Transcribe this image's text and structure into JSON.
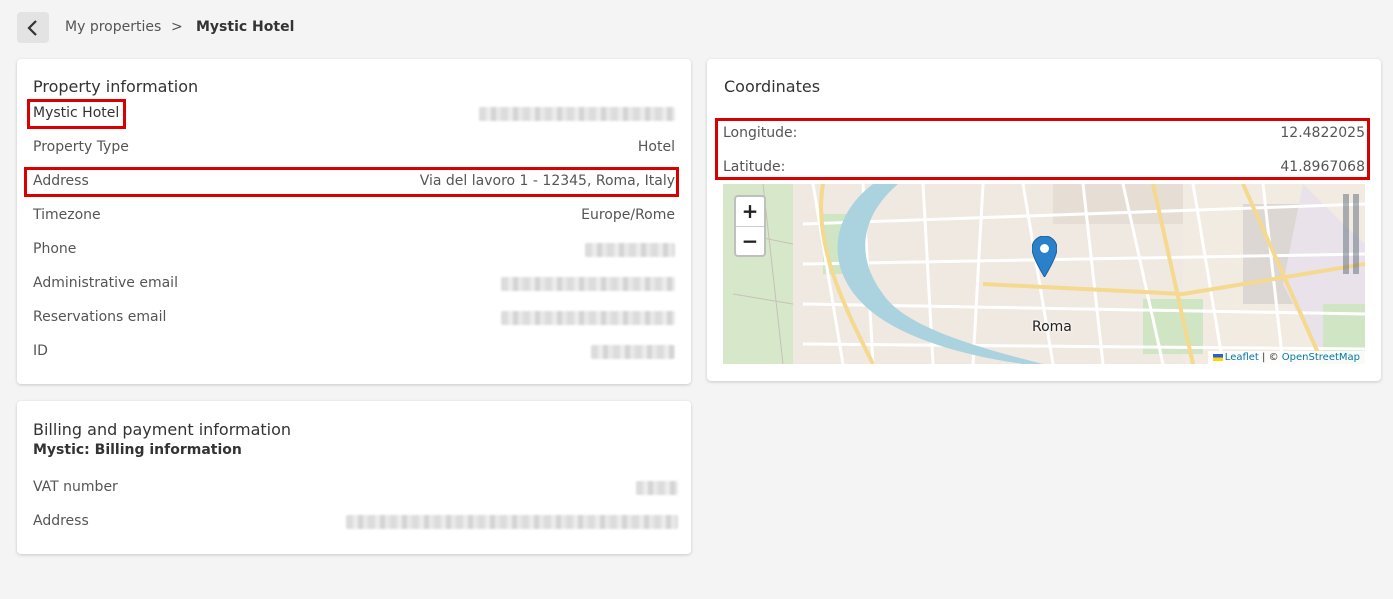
{
  "breadcrumb": {
    "back_icon": "chevron-left-icon",
    "parent": "My properties",
    "separator": ">",
    "current": "Mystic Hotel"
  },
  "property_info": {
    "title": "Property information",
    "name": "Mystic Hotel",
    "rows": [
      {
        "label": "Property Type",
        "value": "Hotel"
      },
      {
        "label": "Address",
        "value": "Via del lavoro 1 - 12345, Roma, Italy"
      },
      {
        "label": "Timezone",
        "value": "Europe/Rome"
      },
      {
        "label": "Phone",
        "value": ""
      },
      {
        "label": "Administrative email",
        "value": ""
      },
      {
        "label": "Reservations email",
        "value": ""
      },
      {
        "label": "ID",
        "value": ""
      }
    ]
  },
  "billing": {
    "title": "Billing and payment information",
    "subtitle": "Mystic: Billing information",
    "rows": [
      {
        "label": "VAT number",
        "value": ""
      },
      {
        "label": "Address",
        "value": ""
      }
    ]
  },
  "coordinates": {
    "title": "Coordinates",
    "longitude_label": "Longitude:",
    "longitude_value": "12.4822025",
    "latitude_label": "Latitude:",
    "latitude_value": "41.8967068",
    "map": {
      "zoom_in": "+",
      "zoom_out": "−",
      "city_label": "Roma",
      "marker_icon": "map-marker-icon",
      "attribution_leaflet": "Leaflet",
      "attribution_sep": "| ©",
      "attribution_osm": "OpenStreetMap"
    }
  },
  "colors": {
    "highlight": "#d90000",
    "marker": "#2a81cb",
    "link": "#0078a8"
  }
}
